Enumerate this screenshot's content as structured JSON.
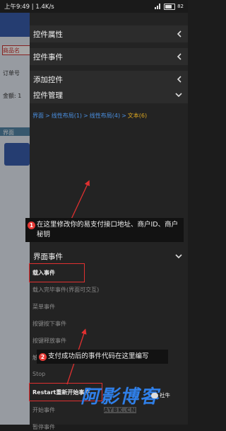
{
  "status_bar": {
    "time_speed": "上午9:49 | 1.4K/s",
    "battery": "82"
  },
  "background_app": {
    "labels": [
      "商品名",
      "订单号",
      "金额: 1",
      "界面"
    ]
  },
  "panel": {
    "sections": [
      {
        "label": "控件属性",
        "chevron": "chevron-left"
      },
      {
        "label": "控件事件",
        "chevron": "chevron-left"
      },
      {
        "label": "添加控件",
        "chevron": "chevron-left"
      },
      {
        "label": "控件管理",
        "chevron": "chevron-down"
      }
    ],
    "breadcrumb": {
      "items": [
        "界面",
        "线性布局(1)",
        "线性布局(4)",
        "文本(6)"
      ],
      "separator": ">"
    },
    "interface_events_header": "界面事件",
    "events": [
      "载入事件",
      "载入完毕事件(界面可交互)",
      "菜单事件",
      "按键按下事件",
      "按键释放事件",
      "触",
      "Stop",
      "Restart重新开始事件",
      "开始事件",
      "暂停事件"
    ]
  },
  "annotations": [
    {
      "number": "1",
      "text": "在这里修改你的易支付接口地址、商户ID、商户秘钥"
    },
    {
      "number": "2",
      "text": "支付成功后的事件代码在这里编写"
    }
  ],
  "watermark": {
    "chinese": "阿影博客",
    "english": "AYBK.CN",
    "wechat": "社牛"
  },
  "colors": {
    "accent_link": "#4a8fe0",
    "accent_current": "#d9a520",
    "highlight_box": "#e03030",
    "watermark_blue": "#2f7fe8"
  }
}
